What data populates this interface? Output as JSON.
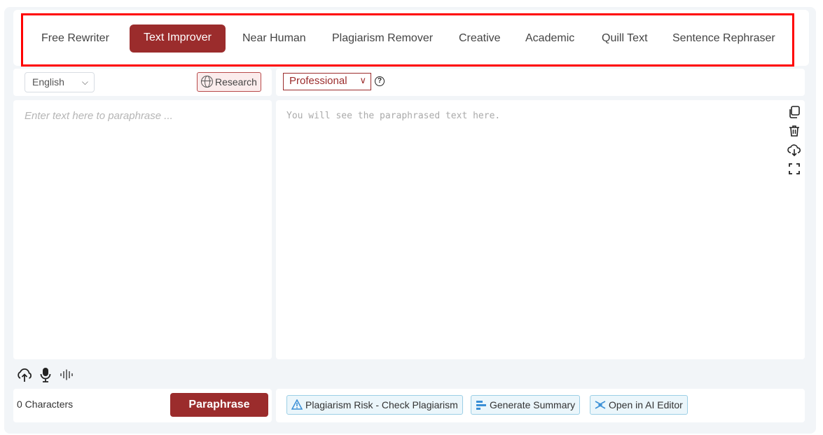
{
  "tabs": [
    {
      "label": "Free Rewriter"
    },
    {
      "label": "Text Improver",
      "active": true
    },
    {
      "label": "Near Human"
    },
    {
      "label": "Plagiarism Remover"
    },
    {
      "label": "Creative"
    },
    {
      "label": "Academic"
    },
    {
      "label": "Quill Text"
    },
    {
      "label": "Sentence Rephraser"
    }
  ],
  "input_panel": {
    "language": "English",
    "research_label": "Research",
    "placeholder": "Enter text here to paraphrase ...",
    "char_count": "0 Characters",
    "paraphrase_label": "Paraphrase"
  },
  "output_panel": {
    "tone": "Professional",
    "placeholder": "You will see the paraphrased text here.",
    "actions": {
      "plagiarism": "Plagiarism Risk - Check Plagiarism",
      "summary": "Generate Summary",
      "editor": "Open in AI Editor"
    }
  },
  "icons": {
    "copy": "copy-icon",
    "delete": "trash-icon",
    "download": "download-icon",
    "fullscreen": "fullscreen-icon",
    "upload": "cloud-upload-icon",
    "mic": "microphone-icon",
    "audio": "audio-wave-icon"
  },
  "colors": {
    "accent": "#9b2c2c",
    "highlight": "#ff0000",
    "action_border": "#9ccfe6"
  }
}
